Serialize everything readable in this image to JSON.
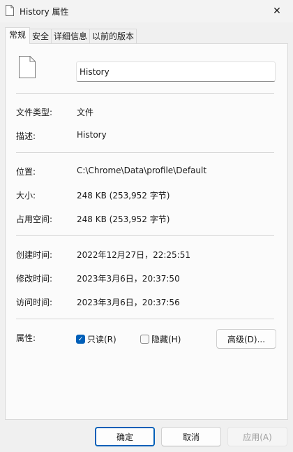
{
  "window": {
    "title": "History 属性",
    "close_glyph": "✕"
  },
  "tabs": [
    {
      "label": "常规",
      "active": true
    },
    {
      "label": "安全",
      "active": false
    },
    {
      "label": "详细信息",
      "active": false
    },
    {
      "label": "以前的版本",
      "active": false
    }
  ],
  "general": {
    "file_name": "History",
    "file_type_label": "文件类型:",
    "file_type_value": "文件",
    "description_label": "描述:",
    "description_value": "History",
    "location_label": "位置:",
    "location_value": "C:\\Chrome\\Data\\profile\\Default",
    "size_label": "大小:",
    "size_value": "248 KB (253,952 字节)",
    "size_on_disk_label": "占用空间:",
    "size_on_disk_value": "248 KB (253,952 字节)",
    "created_label": "创建时间:",
    "created_value": "2022年12月27日，22:25:51",
    "modified_label": "修改时间:",
    "modified_value": "2023年3月6日，20:37:50",
    "accessed_label": "访问时间:",
    "accessed_value": "2023年3月6日，20:37:56",
    "attributes_label": "属性:",
    "readonly_label": "只读(R)",
    "readonly_checked": true,
    "hidden_label": "隐藏(H)",
    "hidden_checked": false,
    "advanced_label": "高级(D)..."
  },
  "footer": {
    "ok_label": "确定",
    "cancel_label": "取消",
    "apply_label": "应用(A)"
  },
  "colors": {
    "accent": "#005fb8",
    "panel_bg": "#fbfbfb",
    "window_bg": "#f0f0f0"
  }
}
